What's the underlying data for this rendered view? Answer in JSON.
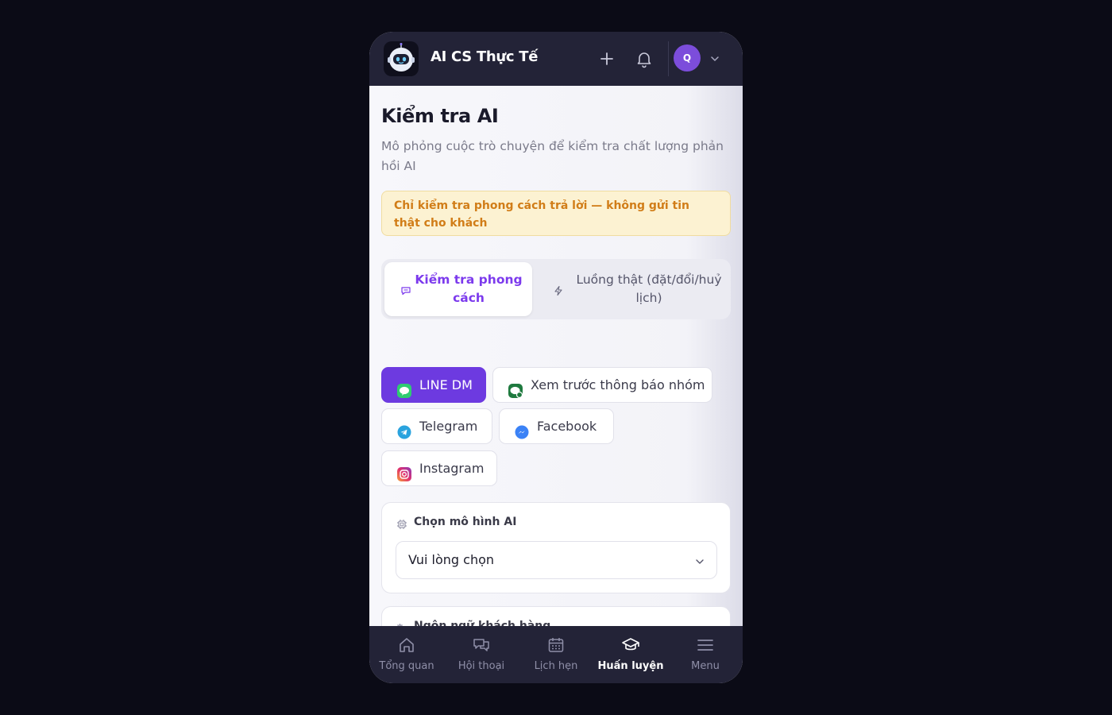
{
  "app": {
    "title": "AI CS Thực Tế",
    "avatar_initial": "Q"
  },
  "page": {
    "title": "Kiểm tra AI",
    "subtitle": "Mô phỏng cuộc trò chuyện để kiểm tra chất lượng phản hồi AI",
    "warning": "Chỉ kiểm tra phong cách trả lời — không gửi tin thật cho khách"
  },
  "segment": {
    "tabs": [
      {
        "label": "Kiểm tra phong cách",
        "icon": "chat-bubble-icon",
        "active": true
      },
      {
        "label": "Luồng thật (đặt/đổi/huỷ lịch)",
        "icon": "lightning-icon",
        "active": false
      }
    ]
  },
  "channels": [
    {
      "label": "LINE DM",
      "icon": "line-icon",
      "active": true
    },
    {
      "label": "Xem trước thông báo nhóm",
      "icon": "line-group-icon",
      "active": false
    },
    {
      "label": "Telegram",
      "icon": "telegram-icon",
      "active": false
    },
    {
      "label": "Facebook",
      "icon": "messenger-icon",
      "active": false
    },
    {
      "label": "Instagram",
      "icon": "instagram-icon",
      "active": false
    }
  ],
  "model_card": {
    "label": "Chọn mô hình AI",
    "value": "Vui lòng chọn",
    "icon": "cpu-icon"
  },
  "language_card": {
    "label": "Ngôn ngữ khách hàng",
    "icon": "translate-icon"
  },
  "nav": [
    {
      "label": "Tổng quan",
      "icon": "home-icon",
      "active": false
    },
    {
      "label": "Hội thoại",
      "icon": "chat-icon",
      "active": false
    },
    {
      "label": "Lịch hẹn",
      "icon": "calendar-icon",
      "active": false
    },
    {
      "label": "Huấn luyện",
      "icon": "graduation-cap-icon",
      "active": true
    },
    {
      "label": "Menu",
      "icon": "menu-icon",
      "active": false
    }
  ],
  "colors": {
    "accent": "#6d3ae0",
    "topbar": "#232337",
    "warning_text": "#d17d18",
    "warning_bg": "#fcf2d2",
    "backdrop": "#0b0b16"
  }
}
